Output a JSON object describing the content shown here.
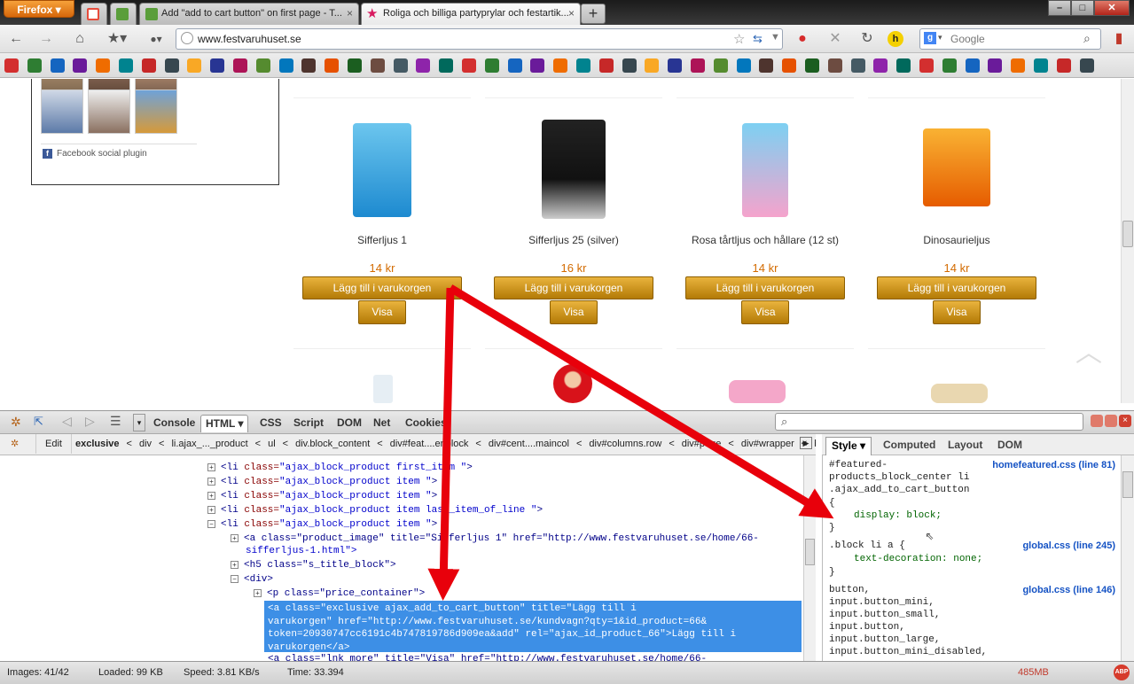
{
  "browser": {
    "menu_button": "Firefox",
    "tabs": [
      {
        "label": "",
        "icon": "gmail-icon",
        "color": "#e74c3c"
      },
      {
        "label": "",
        "icon": "page-icon",
        "color": "#5a9e3a"
      },
      {
        "label": "Add \"add to cart button\" on first page - T...",
        "icon": "page-icon",
        "color": "#5a9e3a"
      },
      {
        "label": "Roliga och billiga partyprylar och festartik...",
        "icon": "star-icon",
        "color": "#d81b60"
      }
    ],
    "new_tab": "+",
    "url": "www.festvaruhuset.se",
    "search_engine": "Google",
    "search_placeholder": "Google"
  },
  "page": {
    "facebook_plugin_label": "Facebook social plugin",
    "products": [
      {
        "name": "Sifferljus 1",
        "price": "14 kr",
        "cart_label": "Lägg till i varukorgen",
        "view_label": "Visa",
        "color": "#2aa0d8"
      },
      {
        "name": "Sifferljus 25 (silver)",
        "price": "16 kr",
        "cart_label": "Lägg till i varukorgen",
        "view_label": "Visa",
        "color": "#222222"
      },
      {
        "name": "Rosa tårtljus och hållare (12 st)",
        "price": "14 kr",
        "cart_label": "Lägg till i varukorgen",
        "view_label": "Visa",
        "color": "#2aa0d8"
      },
      {
        "name": "Dinosaurieljus",
        "price": "14 kr",
        "cart_label": "Lägg till i varukorgen",
        "view_label": "Visa",
        "color": "#f08a00"
      }
    ]
  },
  "firebug": {
    "tabs": [
      "Console",
      "HTML",
      "CSS",
      "Script",
      "DOM",
      "Net",
      "Cookies"
    ],
    "active_tab": "HTML",
    "edit_label": "Edit",
    "breadcrumbs": [
      "exclusive",
      "div",
      "li.ajax_..._product",
      "ul",
      "div.block_content",
      "div#feat....er.block",
      "div#cent....maincol",
      "div#columns.row",
      "div#page",
      "div#wrapper",
      "bo"
    ],
    "side_tabs": [
      "Style",
      "Computed",
      "Layout",
      "DOM"
    ],
    "html_lines": [
      {
        "tag": "<li ",
        "attr": "class=",
        "val": "\"ajax_block_product first_item \"",
        "end": ">"
      },
      {
        "tag": "<li ",
        "attr": "class=",
        "val": "\"ajax_block_product item \"",
        "end": ">"
      },
      {
        "tag": "<li ",
        "attr": "class=",
        "val": "\"ajax_block_product item \"",
        "end": ">"
      },
      {
        "tag": "<li ",
        "attr": "class=",
        "val": "\"ajax_block_product item last_item_of_line \"",
        "end": ">"
      },
      {
        "tag": "<li ",
        "attr": "class=",
        "val": "\"ajax_block_product item \"",
        "end": ">"
      }
    ],
    "product_image_line": "<a class=\"product_image\" title=\"Sifferljus 1\" href=\"http://www.festvaruhuset.se/home/66-",
    "product_image_line2": "sifferljus-1.html\">",
    "h5_line": "<h5 class=\"s_title_block\">",
    "div_line": "<div>",
    "p_line": "<p class=\"price_container\">",
    "selected_line1": "<a class=\"exclusive ajax_add_to_cart_button\" title=\"Lägg till i",
    "selected_line2": "varukorgen\" href=\"http://www.festvaruhuset.se/kundvagn?qty=1&id_product=66&",
    "selected_line3": "token=20930747cc6191c4b747819786d909ea&add\" rel=\"ajax_id_product_66\">Lägg till i",
    "selected_line4": "varukorgen</a>",
    "more_line": "<a class=\"lnk_more\" title=\"Visa\" href=\"http://www.festvaruhuset.se/home/66-",
    "style_rules": {
      "rule1_selector1": "#featured-",
      "rule1_selector2": "products_block_center li",
      "rule1_selector3": ".ajax_add_to_cart_button",
      "rule1_source": "homefeatured.css (line 81)",
      "rule1_prop": "display: block;",
      "rule2_selector": ".block li a {",
      "rule2_source": "global.css (line 245)",
      "rule2_prop": "text-decoration: none;",
      "rule3_sel1": "button,",
      "rule3_sel2": "input.button_mini,",
      "rule3_sel3": "input.button_small,",
      "rule3_sel4": "input.button,",
      "rule3_sel5": "input.button_large,",
      "rule3_sel6": "input.button_mini_disabled,",
      "rule3_source": "global.css (line 146)",
      "open_brace": "{",
      "close_brace": "}"
    }
  },
  "status": {
    "images": "Images: 41/42",
    "loaded": "Loaded: 99 KB",
    "speed": "Speed: 3.81 KB/s",
    "time": "Time: 33.394",
    "memory": "485MB"
  },
  "colors": {
    "accent_button": "#c68c12",
    "price": "#d36b00",
    "selection": "#3d8fe6",
    "arrow": "#e8000b"
  }
}
